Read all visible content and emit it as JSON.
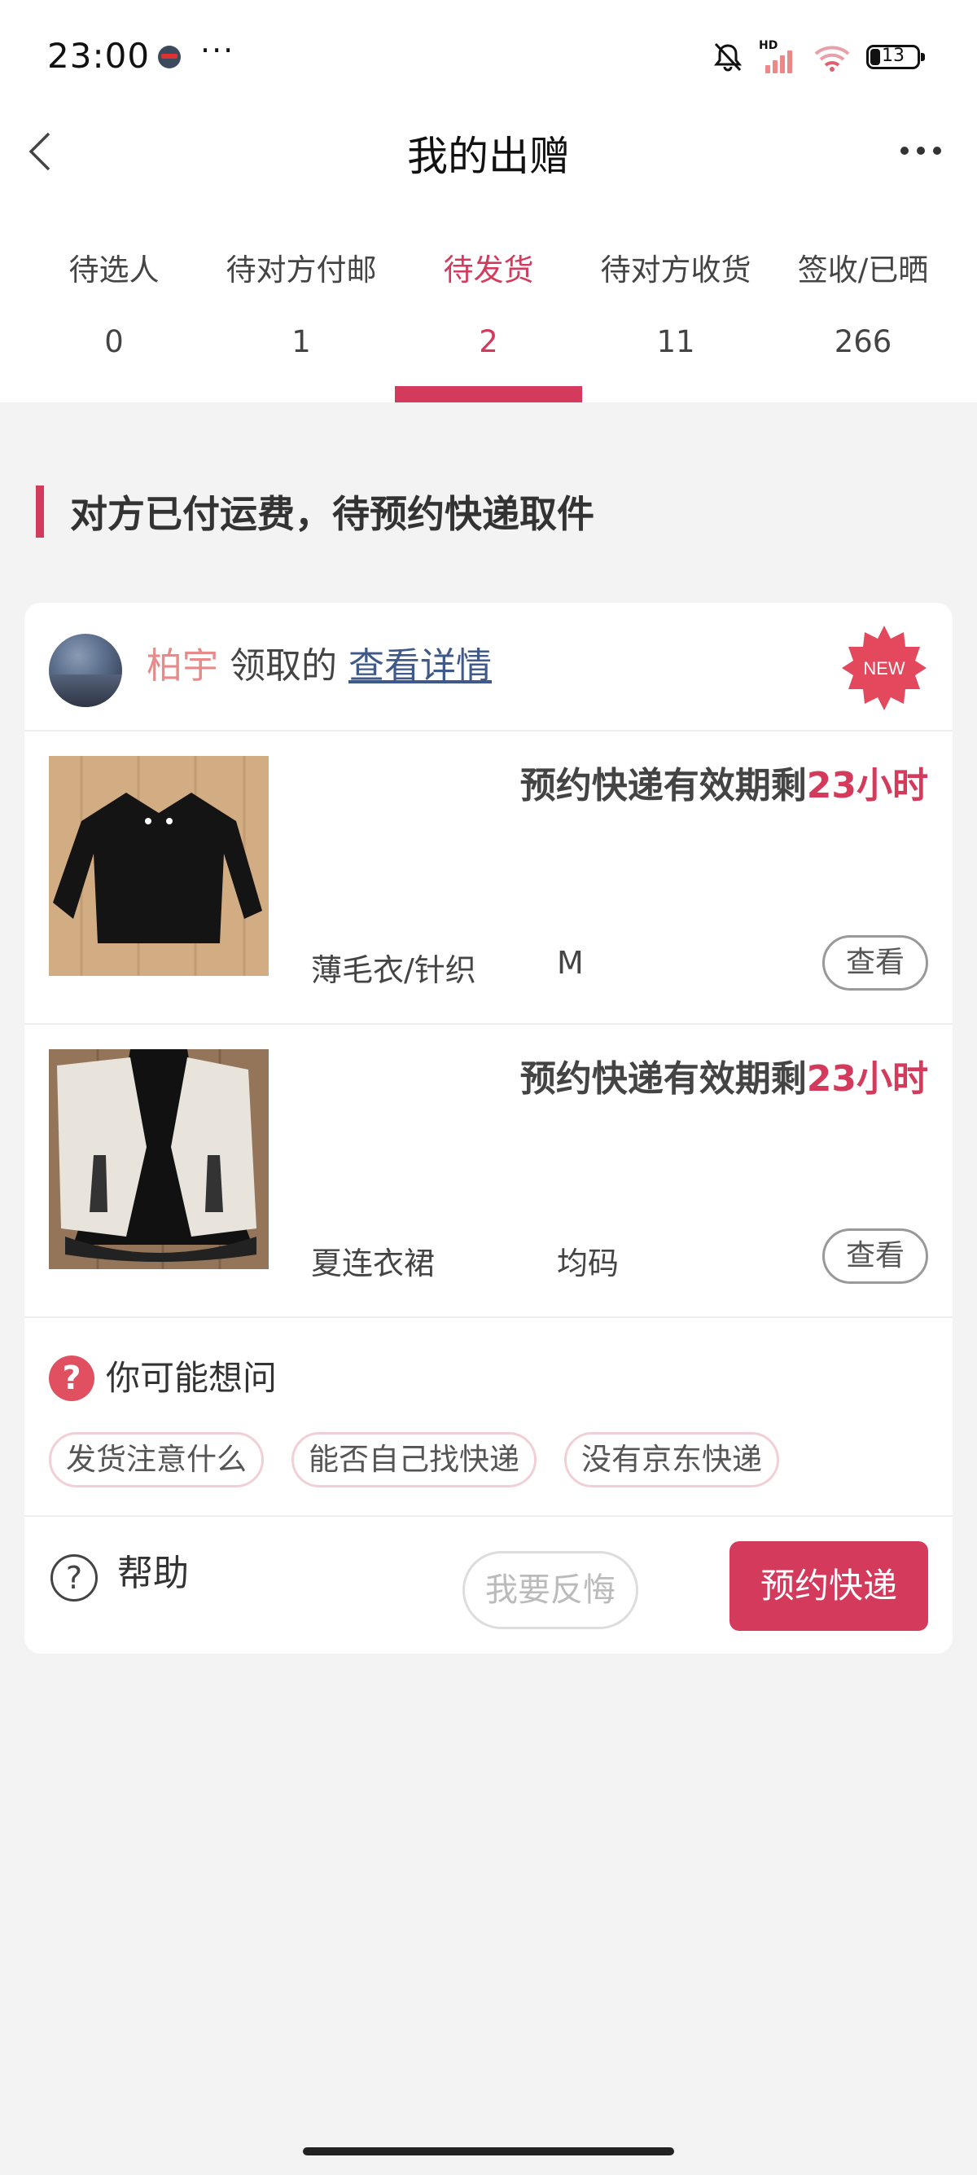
{
  "status_bar": {
    "time": "23:00",
    "more": "···",
    "battery": "13"
  },
  "nav": {
    "title": "我的出赠"
  },
  "tabs": [
    {
      "label": "待选人",
      "count": "0"
    },
    {
      "label": "待对方付邮",
      "count": "1"
    },
    {
      "label": "待发货",
      "count": "2"
    },
    {
      "label": "待对方收货",
      "count": "11"
    },
    {
      "label": "签收/已晒",
      "count": "266"
    }
  ],
  "section": {
    "heading": "对方已付运费，待预约快递取件"
  },
  "card": {
    "recipient": "柏宇",
    "claimed_text": "领取的",
    "detail_link": "查看详情",
    "badge": "NEW",
    "items": [
      {
        "deadline_prefix": "预约快递有效期剩",
        "deadline_hours": "23小时",
        "category": "薄毛衣/针织",
        "size": "M",
        "view_label": "查看"
      },
      {
        "deadline_prefix": "预约快递有效期剩",
        "deadline_hours": "23小时",
        "category": "夏连衣裙",
        "size": "均码",
        "view_label": "查看"
      }
    ],
    "faq": {
      "icon_text": "?",
      "title": "你可能想问",
      "chips": [
        "发货注意什么",
        "能否自己找快递",
        "没有京东快递"
      ]
    },
    "actions": {
      "help_icon_text": "?",
      "help_label": "帮助",
      "regret_label": "我要反悔",
      "book_label": "预约快递"
    }
  },
  "colors": {
    "accent": "#d33a5b",
    "name": "#e68a8a",
    "link": "#3f5a8a",
    "background": "#f3f3f4"
  }
}
